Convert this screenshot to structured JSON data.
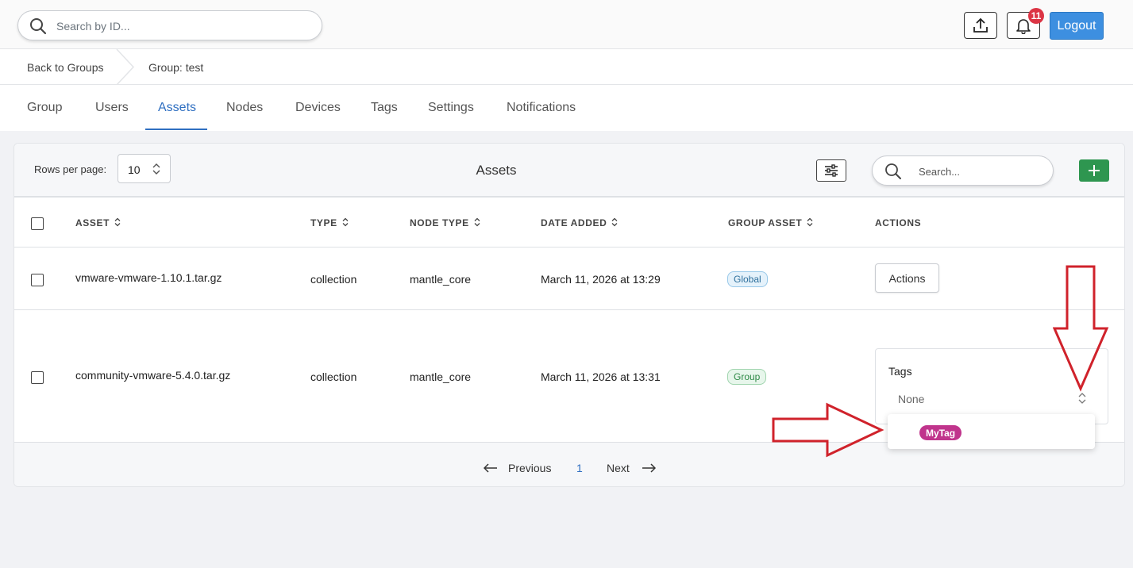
{
  "topbar": {
    "search_placeholder": "Search by ID...",
    "notification_count": "11",
    "logout_label": "Logout"
  },
  "breadcrumb": {
    "back": "Back to Groups",
    "current": "Group: test"
  },
  "tabs": [
    {
      "label": "Group"
    },
    {
      "label": "Users"
    },
    {
      "label": "Assets",
      "active": true
    },
    {
      "label": "Nodes"
    },
    {
      "label": "Devices"
    },
    {
      "label": "Tags"
    },
    {
      "label": "Settings"
    },
    {
      "label": "Notifications"
    }
  ],
  "assets_card": {
    "rows_per_page_label": "Rows per page:",
    "rows_per_page_value": "10",
    "title": "Assets",
    "search_placeholder": "Search...",
    "columns": [
      "ASSET",
      "TYPE",
      "NODE TYPE",
      "DATE ADDED",
      "GROUP ASSET",
      "ACTIONS"
    ],
    "rows": [
      {
        "asset": "vmware-vmware-1.10.1.tar.gz",
        "type": "collection",
        "node_type": "mantle_core",
        "date_added": "March 11, 2026 at 13:29",
        "group_asset": "Global",
        "action_label": "Actions"
      },
      {
        "asset": "community-vmware-5.4.0.tar.gz",
        "type": "collection",
        "node_type": "mantle_core",
        "date_added": "March 11, 2026 at 13:31",
        "group_asset": "Group"
      }
    ],
    "tags_panel": {
      "label": "Tags",
      "value": "None",
      "options": [
        "MyTag"
      ]
    },
    "pagination": {
      "previous": "Previous",
      "page": "1",
      "next": "Next"
    }
  },
  "colors": {
    "accent": "#2f6fc1",
    "logout_bg": "#3d8fe0",
    "add_button": "#2e9650",
    "badge": "#dc3545",
    "tag_pill": "#c0348c",
    "annotation_arrow": "#d0222b"
  }
}
